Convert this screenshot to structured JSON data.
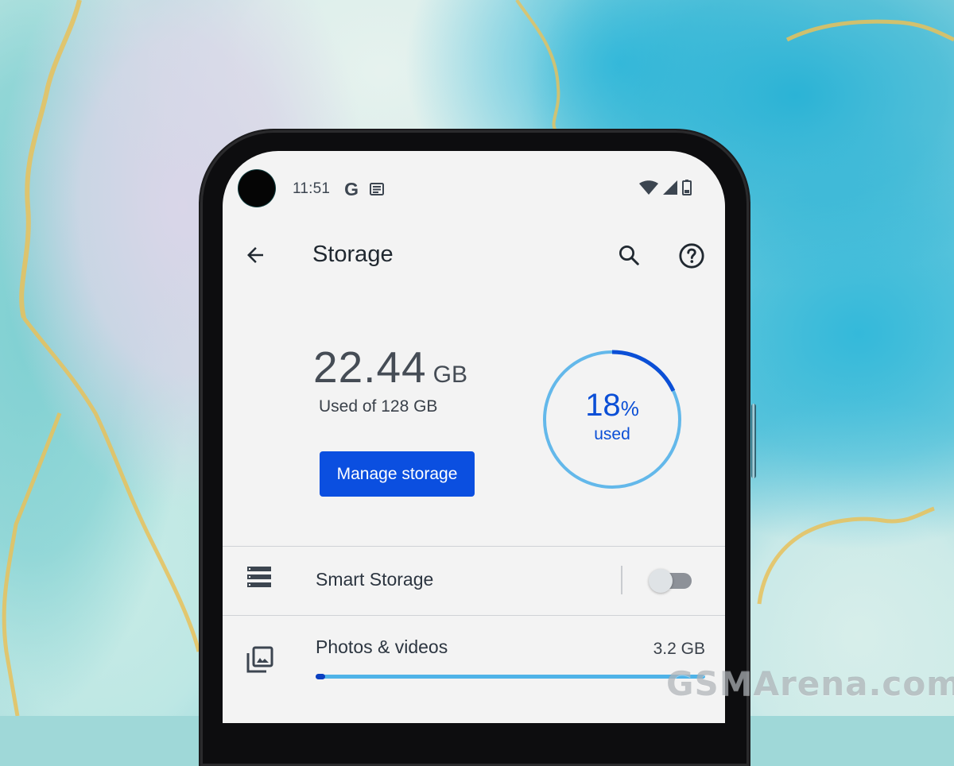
{
  "status_bar": {
    "time": "11:51",
    "left_icons": [
      "google-icon",
      "news-icon"
    ],
    "right_icons": [
      "wifi-icon",
      "cellular-signal-icon",
      "battery-icon"
    ],
    "google_glyph": "G"
  },
  "app_bar": {
    "title": "Storage",
    "icons": [
      "back-arrow-icon",
      "search-icon",
      "help-icon"
    ]
  },
  "summary": {
    "used_value": "22.44",
    "used_unit": "GB",
    "used_of_label": "Used of 128 GB",
    "manage_button_label": "Manage storage",
    "percent_used": 18,
    "percent_number": "18",
    "percent_sign": "%",
    "percent_caption": "used"
  },
  "rows": [
    {
      "icon": "smart-storage-icon",
      "label": "Smart Storage",
      "toggle_on": false
    },
    {
      "icon": "photos-icon",
      "label": "Photos & videos",
      "value": "3.2 GB",
      "usage_fraction": 0.025
    }
  ],
  "colors": {
    "accent": "#0b4fe0",
    "ring_track": "#63b8ea",
    "ring_fill": "#0b4fd6",
    "screen_bg": "#f3f3f3",
    "text_primary": "#202830"
  },
  "watermark": "GSMArena.com"
}
